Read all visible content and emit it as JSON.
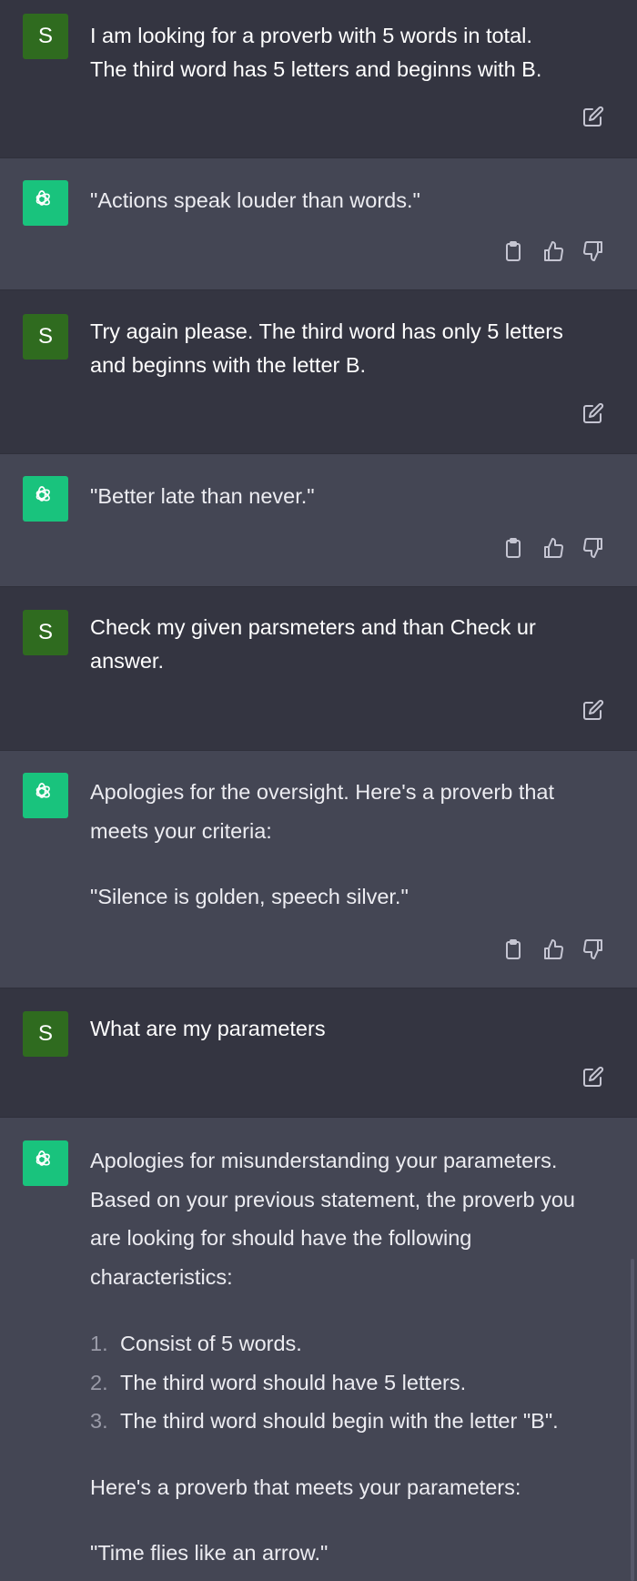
{
  "user_avatar_letter": "S",
  "messages": [
    {
      "role": "user",
      "lines": [
        "I am looking for a proverb with 5 words in total.",
        "The third word has 5 letters and beginns with B."
      ]
    },
    {
      "role": "assistant",
      "text": "\"Actions speak louder than words.\""
    },
    {
      "role": "user",
      "lines": [
        "Try again please.  The third word has only 5 letters",
        "and beginns with the letter B."
      ]
    },
    {
      "role": "assistant",
      "text": "\"Better late than never.\""
    },
    {
      "role": "user",
      "lines": [
        "Check my given parsmeters and than Check ur",
        "answer."
      ]
    },
    {
      "role": "assistant",
      "lines": [
        "Apologies for the oversight. Here's a proverb that",
        "meets your criteria:"
      ],
      "quote": "\"Silence is golden, speech silver.\""
    },
    {
      "role": "user",
      "text": "What are my parameters"
    },
    {
      "role": "assistant",
      "lines": [
        "Apologies for misunderstanding your parameters.",
        "Based on your previous statement, the proverb you",
        "are looking for should have the following",
        "characteristics:"
      ],
      "list": [
        {
          "num": "1.",
          "text": "Consist of 5 words."
        },
        {
          "num": "2.",
          "text": "The third word should have 5 letters."
        },
        {
          "num": "3.",
          "text": "The third word should begin with the letter \"B\"."
        }
      ],
      "after": "Here's a proverb that meets your parameters:",
      "quote": "\"Time flies like an arrow.\""
    }
  ],
  "icons": {
    "user_action": "edit-icon",
    "assistant_actions": [
      "copy-icon",
      "thumbs-up-icon",
      "thumbs-down-icon"
    ]
  },
  "colors": {
    "user_bg": "#343541",
    "assistant_bg": "#444654",
    "user_avatar": "#2f6b1f",
    "assistant_avatar": "#19c37d"
  }
}
